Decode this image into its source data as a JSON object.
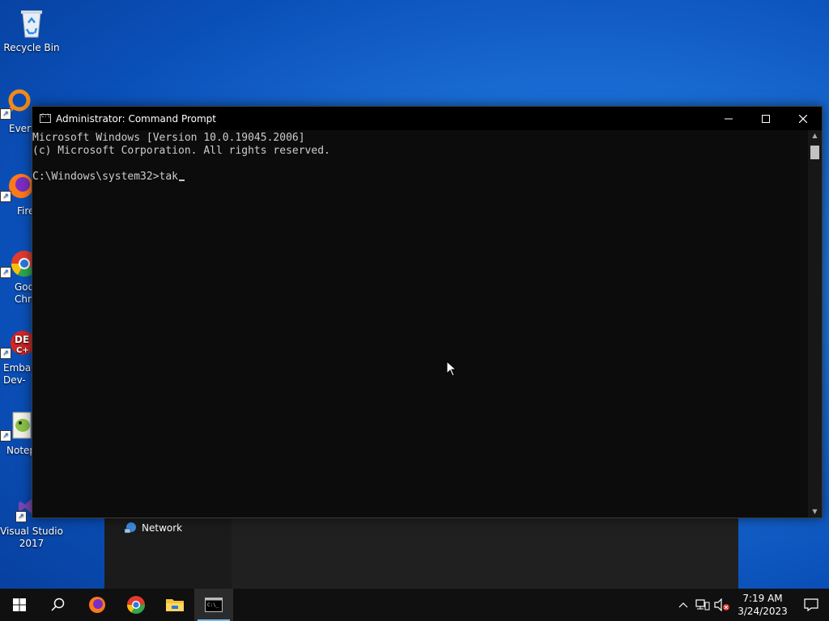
{
  "desktop": {
    "icons": [
      {
        "label": "Recycle Bin"
      },
      {
        "label": "Every"
      },
      {
        "label": "Fire"
      },
      {
        "label": "Goo\nChro"
      },
      {
        "label": "Embar\nDev-"
      },
      {
        "label": "Notep"
      },
      {
        "label": "Visual Studio\n2017"
      }
    ]
  },
  "explorer_fragment": {
    "network_label": "Network"
  },
  "cmd_window": {
    "title": "Administrator: Command Prompt",
    "lines": [
      "Microsoft Windows [Version 10.0.19045.2006]",
      "(c) Microsoft Corporation. All rights reserved.",
      "",
      "C:\\Windows\\system32>tak"
    ]
  },
  "taskbar": {
    "clock_time": "7:19 AM",
    "clock_date": "3/24/2023"
  },
  "colors": {
    "console_bg": "#0c0c0c",
    "console_text": "#cccccc",
    "taskbar_bg": "#101010",
    "active_indicator": "#76b9ed"
  }
}
